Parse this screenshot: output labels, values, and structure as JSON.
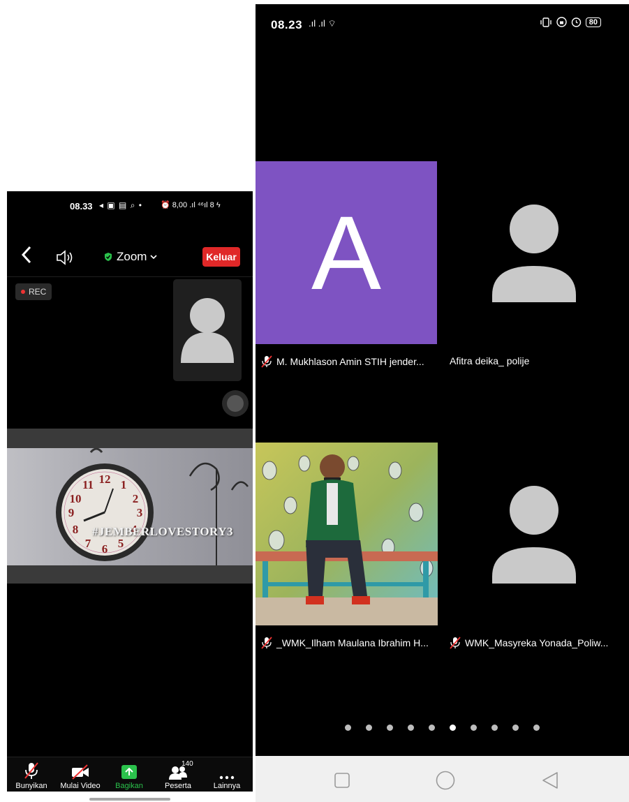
{
  "left_phone": {
    "status_bar": {
      "time": "08.33",
      "icons": "◂ ▣ ▤ ⌕ •",
      "right": "⏰ 8,00 .ıl ⁴⁶ıl 8 ϟ"
    },
    "topbar": {
      "back_icon": "chevron-left",
      "audio_icon": "speaker",
      "meeting_label": "Zoom",
      "leave_label": "Keluar"
    },
    "rec_label": "REC",
    "share_hashtag": "#JEMBERLOVESTORY3",
    "toolbar": [
      {
        "label": "Bunyikan",
        "icon": "mic-off"
      },
      {
        "label": "Mulai Video",
        "icon": "video-off"
      },
      {
        "label": "Bagikan",
        "icon": "share"
      },
      {
        "label": "Peserta",
        "icon": "participants",
        "badge": "140"
      },
      {
        "label": "Lainnya",
        "icon": "more"
      }
    ],
    "accent_green": "#2bc24c",
    "leave_red": "#e02828"
  },
  "right_phone": {
    "status_bar": {
      "time": "08.23",
      "signal": ".ıl .ıl ⌔",
      "battery": "80"
    },
    "participants": [
      {
        "name": "M. Mukhlason Amin STIH jender...",
        "avatar": "A",
        "avatar_color": "#7e53c2",
        "muted": true
      },
      {
        "name": "Afitra deika_ polije",
        "avatar": "person-placeholder",
        "muted": false
      },
      {
        "name": "_WMK_Ilham Maulana Ibrahim H...",
        "avatar": "photo",
        "muted": true
      },
      {
        "name": "WMK_Masyreka Yonada_Poliw...",
        "avatar": "person-placeholder",
        "muted": true
      }
    ],
    "page_dots": {
      "total": 10,
      "active": 5
    },
    "nav_buttons": [
      "recent-apps",
      "home",
      "back"
    ]
  }
}
